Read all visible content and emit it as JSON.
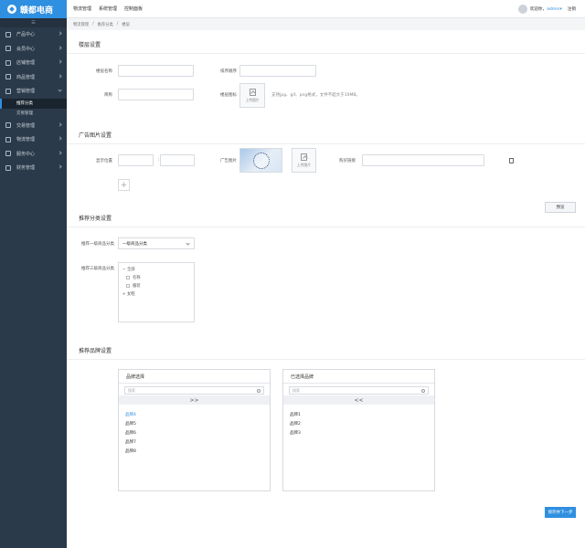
{
  "app": {
    "logo_text": "赣都电商",
    "collapse_label": "☰"
  },
  "sidebar": {
    "items": [
      {
        "label": "产品中心",
        "icon": "grid-icon"
      },
      {
        "label": "会员中心",
        "icon": "star-icon"
      },
      {
        "label": "店铺管理",
        "icon": "store-icon"
      },
      {
        "label": "商品管理",
        "icon": "box-icon"
      },
      {
        "label": "营销管理",
        "icon": "flame-icon",
        "open": true
      },
      {
        "label": "交易管理",
        "icon": "list-icon"
      },
      {
        "label": "物流管理",
        "icon": "cart-icon"
      },
      {
        "label": "服务中心",
        "icon": "cube-icon"
      },
      {
        "label": "财务管理",
        "icon": "tag-icon"
      }
    ],
    "sub_items": [
      {
        "label": "推荐分类",
        "active": true
      },
      {
        "label": "交易管理"
      }
    ]
  },
  "topnav": {
    "items": [
      "物流管理",
      "系统管理",
      "控制面板"
    ]
  },
  "user": {
    "greeting": "欢迎你，",
    "name": "admin",
    "dropdown": "▾",
    "logout": "注销"
  },
  "breadcrumb": [
    "物流管理",
    "推荐分类",
    "楼层"
  ],
  "basic": {
    "title": "楼层设置",
    "name_label": "楼层名称",
    "order_label": "排序顺序",
    "short_label": "简称",
    "icon_label": "楼层图标",
    "upload_label": "上传图片",
    "upload_note": "支持jpg、gif、png格式，文件不超大于10MB。"
  },
  "ad": {
    "title": "广告图片设置",
    "position_label": "显示位置",
    "colon": ":",
    "image_label": "广告图片",
    "upload_label": "上传图片",
    "link_label": "购买链接",
    "preview_button": "预览"
  },
  "category": {
    "title": "推荐分类设置",
    "level1_label": "推荐一级商品分类",
    "level1_value": "一级商品分类",
    "level3_label": "推荐三级商品分类",
    "tree": [
      {
        "label": "− 全部",
        "indent": 0,
        "checkbox": false
      },
      {
        "label": "名称",
        "indent": 1,
        "checkbox": true
      },
      {
        "label": "服装",
        "indent": 1,
        "checkbox": true
      },
      {
        "label": "+ 女鞋",
        "indent": 0,
        "checkbox": false
      }
    ]
  },
  "brand": {
    "title": "推荐品牌设置",
    "left_title": "品牌选择",
    "right_title": "已选择品牌",
    "search_placeholder": "搜索",
    "move_right": ">>",
    "move_left": "<<",
    "left_items": [
      "品牌4",
      "品牌5",
      "品牌6",
      "品牌7",
      "品牌8"
    ],
    "right_items": [
      "品牌1",
      "品牌2",
      "品牌3"
    ],
    "save_button": "保存并下一步"
  },
  "colors": {
    "accent": "#2f8fe0",
    "sidebar_bg": "#2b3a4a"
  }
}
